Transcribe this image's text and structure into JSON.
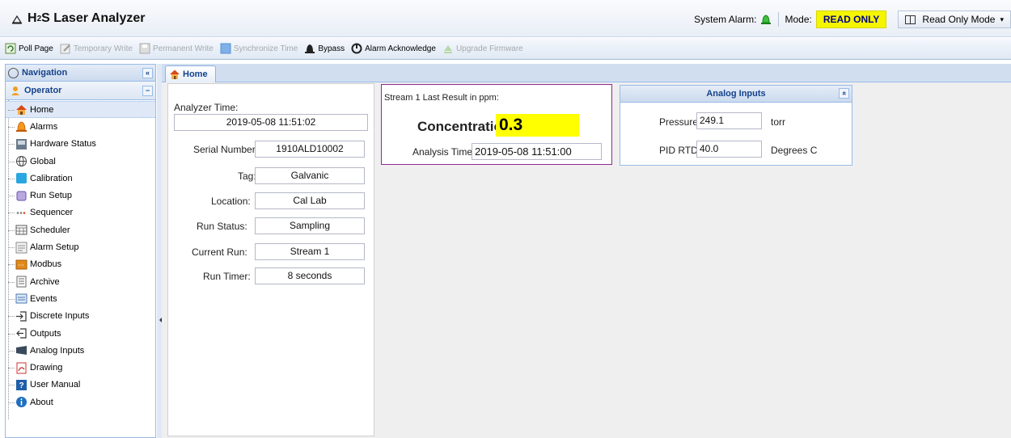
{
  "header": {
    "title_main": "H",
    "title_sub": "2",
    "title_rest": "S Laser Analyzer",
    "system_alarm_label": "System Alarm:",
    "mode_label": "Mode:",
    "mode_value": "READ ONLY",
    "read_only_mode_button": "Read Only Mode"
  },
  "toolbar": {
    "items": [
      {
        "label": "Poll Page",
        "enabled": true,
        "icon": "refresh-page-icon"
      },
      {
        "label": "Temporary Write",
        "enabled": false,
        "icon": "edit-icon"
      },
      {
        "label": "Permanent Write",
        "enabled": false,
        "icon": "save-icon"
      },
      {
        "label": "Synchronize Time",
        "enabled": false,
        "icon": "sync-time-icon"
      },
      {
        "label": "Bypass",
        "enabled": true,
        "icon": "bypass-bell-icon"
      },
      {
        "label": "Alarm Acknowledge",
        "enabled": true,
        "icon": "acknowledge-icon"
      },
      {
        "label": "Upgrade Firmware",
        "enabled": false,
        "icon": "upgrade-icon"
      }
    ]
  },
  "nav": {
    "title": "Navigation",
    "collapse_glyph": "«",
    "section": "Operator",
    "section_glyph": "−",
    "items": [
      {
        "label": "Home",
        "icon": "home-icon"
      },
      {
        "label": "Alarms",
        "icon": "alarm-bell-icon"
      },
      {
        "label": "Hardware Status",
        "icon": "hardware-icon"
      },
      {
        "label": "Global",
        "icon": "globe-icon"
      },
      {
        "label": "Calibration",
        "icon": "calibration-icon"
      },
      {
        "label": "Run Setup",
        "icon": "run-setup-icon"
      },
      {
        "label": "Sequencer",
        "icon": "sequencer-icon"
      },
      {
        "label": "Scheduler",
        "icon": "scheduler-icon"
      },
      {
        "label": "Alarm Setup",
        "icon": "alarm-setup-icon"
      },
      {
        "label": "Modbus",
        "icon": "modbus-icon"
      },
      {
        "label": "Archive",
        "icon": "archive-icon"
      },
      {
        "label": "Events",
        "icon": "events-icon"
      },
      {
        "label": "Discrete Inputs",
        "icon": "discrete-inputs-icon"
      },
      {
        "label": "Outputs",
        "icon": "outputs-icon"
      },
      {
        "label": "Analog Inputs",
        "icon": "analog-inputs-icon"
      },
      {
        "label": "Drawing",
        "icon": "drawing-icon"
      },
      {
        "label": "User Manual",
        "icon": "user-manual-icon"
      },
      {
        "label": "About",
        "icon": "about-icon"
      }
    ]
  },
  "tabs": [
    {
      "label": "Home",
      "active": true
    }
  ],
  "analyzer": {
    "analyzer_time_label": "Analyzer Time:",
    "analyzer_time": "2019-05-08 11:51:02",
    "serial_label": "Serial Number:",
    "serial": "1910ALD10002",
    "tag_label": "Tag:",
    "tag": "Galvanic",
    "location_label": "Location:",
    "location": "Cal Lab",
    "run_status_label": "Run Status:",
    "run_status": "Sampling",
    "current_run_label": "Current Run:",
    "current_run": "Stream 1",
    "run_timer_label": "Run Timer:",
    "run_timer": "8 seconds"
  },
  "result": {
    "heading": "Stream 1 Last Result in ppm:",
    "concentration_label": "Concentration:",
    "concentration_value": "0.3",
    "analysis_time_label": "Analysis Time:",
    "analysis_time": "2019-05-08 11:51:00"
  },
  "analog_inputs": {
    "title": "Analog Inputs",
    "collapse_glyph": "»",
    "rows": [
      {
        "label": "Pressure",
        "value": "249.1",
        "unit": "torr"
      },
      {
        "label": "PID RTD",
        "value": "40.0",
        "unit": "Degrees C"
      }
    ]
  },
  "colors": {
    "mode_badge_bg": "#f5f500",
    "concentration_bg": "#ffff00",
    "panel_header_text": "#15428b",
    "result_border": "#8e2a8e"
  }
}
